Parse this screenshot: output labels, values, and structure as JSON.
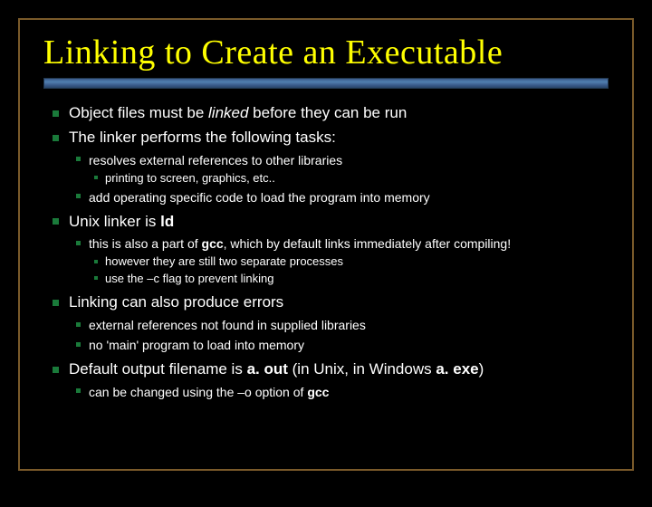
{
  "title": "Linking to Create an Executable",
  "b1": {
    "pre": "Object files must be ",
    "em": "linked",
    "post": " before they can be run"
  },
  "b2": "The linker performs the following tasks:",
  "b2_1": "resolves external references to other libraries",
  "b2_1_1": "printing to screen, graphics, etc..",
  "b2_2": "add operating specific code to load the program into memory",
  "b3": {
    "pre": "Unix linker is ",
    "bold": "ld"
  },
  "b3_1": {
    "pre": "this is also a part of ",
    "bold": "gcc",
    "post": ", which by default links immediately after compiling!"
  },
  "b3_1_1": "however they are still two separate processes",
  "b3_1_2": "use the –c flag to prevent linking",
  "b4": "Linking can also produce errors",
  "b4_1": "external references not found in supplied libraries",
  "b4_2": "no 'main' program to load into memory",
  "b5": {
    "pre": "Default output filename is ",
    "b1": "a. out",
    "mid": " (in Unix, in Windows ",
    "b2": "a. exe",
    "post": ")"
  },
  "b5_1": {
    "pre": "can be changed using the –o option of ",
    "bold": "gcc"
  }
}
